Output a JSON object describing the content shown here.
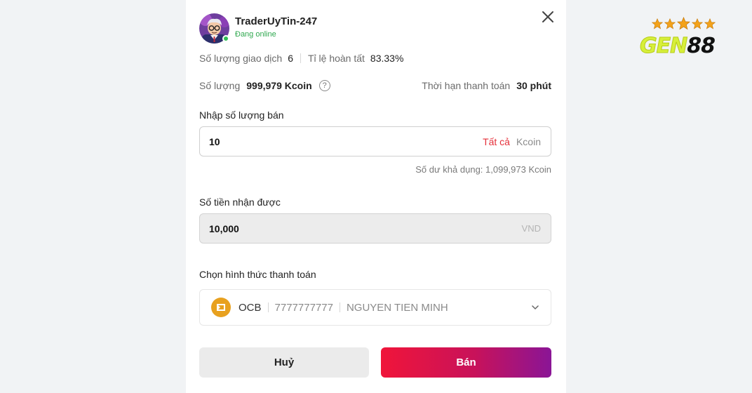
{
  "trader": {
    "name": "TraderUyTin-247",
    "status": "Đang online",
    "trades_label": "Số lượng giao dịch",
    "trades_value": "6",
    "completion_label": "Tỉ lệ hoàn tất",
    "completion_value": "83.33%"
  },
  "offer": {
    "quantity_label": "Số lượng",
    "quantity_value": "999,979 Kcoin",
    "help_glyph": "?",
    "deadline_label": "Thời hạn thanh toán",
    "deadline_value": "30 phút"
  },
  "sell_amount": {
    "label": "Nhập số lượng bán",
    "value": "10",
    "all_link": "Tất cả",
    "unit": "Kcoin",
    "balance": "Số dư khả dụng: 1,099,973 Kcoin"
  },
  "receive_amount": {
    "label": "Số tiền nhận được",
    "value": "10,000",
    "unit": "VND"
  },
  "payment": {
    "label": "Chọn hình thức thanh toán",
    "bank": "OCB",
    "account_number": "7777777777",
    "account_name": "NGUYEN TIEN MINH"
  },
  "actions": {
    "cancel_label": "Huỷ",
    "sell_label": "Bán"
  },
  "brand": {
    "logo_text_a": "GEN",
    "logo_text_b": "88",
    "stars": 5
  },
  "colors": {
    "accent_red": "#e5303a",
    "online_green": "#2fa84f",
    "sell_gradient_start": "#f0153a",
    "sell_gradient_end": "#8a1596",
    "bank_orange": "#e8a11f"
  }
}
